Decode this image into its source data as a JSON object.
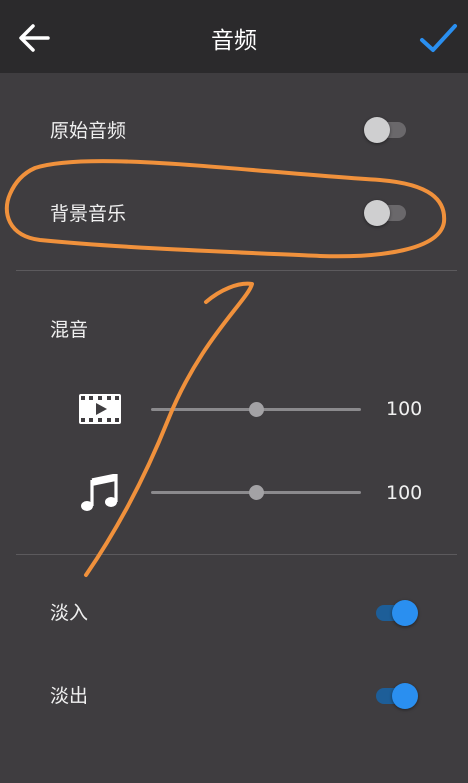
{
  "header": {
    "title": "音频",
    "back_icon": "arrow-left-icon",
    "confirm_icon": "check-icon",
    "accent": "#2a8ff0"
  },
  "audio": {
    "original_audio": {
      "label": "原始音频",
      "enabled": false
    },
    "background_music": {
      "label": "背景音乐",
      "enabled": false
    }
  },
  "mix": {
    "label": "混音",
    "video_volume": {
      "icon": "video-clip-icon",
      "value": "100",
      "level": 0.5
    },
    "music_volume": {
      "icon": "music-note-icon",
      "value": "100",
      "level": 0.5
    }
  },
  "fade": {
    "fade_in": {
      "label": "淡入",
      "enabled": true
    },
    "fade_out": {
      "label": "淡出",
      "enabled": true
    }
  },
  "annotation_color": "#f0913c"
}
